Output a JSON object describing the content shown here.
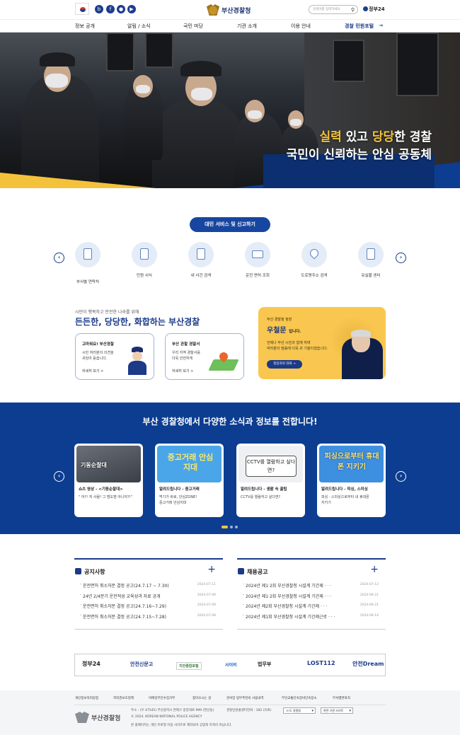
{
  "header": {
    "site_name": "부산경찰청",
    "search_placeholder": "검색어를 입력하세요",
    "gov24": "정부24",
    "nav": [
      "정보 공개",
      "알림 / 소식",
      "국민 마당",
      "기관 소개",
      "이용 안내",
      "경찰 민원포털"
    ]
  },
  "hero": {
    "line1_a": "실력",
    "line1_b": " 있고 ",
    "line1_c": "당당",
    "line1_d": "한 경찰",
    "line2": "국민이 신뢰하는 안심 공동체"
  },
  "services": {
    "title": "대민 서비스 및 신고하기",
    "items": [
      "부서별 연락처",
      "민원 서식",
      "내 사건 검색",
      "운전 면허 조회",
      "도로명주소 검색",
      "유실물 센터"
    ]
  },
  "intro": {
    "subtitle": "시민이 행복하고 안전한 나라를 위해",
    "title": "든든한, 당당한, 화합하는 부산경찰",
    "cards": [
      {
        "title": "고마워요! 부산경찰",
        "desc1": "시민 여러분의 의견을",
        "desc2": "귀담아 듣습니다.",
        "more": "자세히 보기 >"
      },
      {
        "title": "부산 관할 경찰서",
        "desc1": "우리 지역 경찰서를",
        "desc2": "더욱 안전하게",
        "more": "자세히 보기 >"
      }
    ],
    "chief": {
      "label": "부산 경찰청 청장",
      "name": "우철문",
      "suffix": "입니다.",
      "desc1": "언제나 부산 시민과 함께 하며",
      "desc2": "여러분의 말씀에 더욱 귀 기울이겠습니다.",
      "button": "청장과의 대화 →"
    }
  },
  "news": {
    "title": "부산 경찰청에서 다양한 소식과 정보를 전합니다!",
    "cards": [
      {
        "title": "쇼츠 영상 - <기동순찰대>",
        "desc1": "\" 어?! 저 사람! 그 범도범 아니야?!\"",
        "desc2": "",
        "img_text": "기동순찰대"
      },
      {
        "title": "알려드립니다 - 중고거래",
        "desc1": "먹기가 바로, 안심ZONE!",
        "desc2": "중고거래 안심지대",
        "img_text": "중고거래 안심지대"
      },
      {
        "title": "알려드립니다 - 생활 속 꿀팁",
        "desc1": "CCTV를 열람하고 싶다면?",
        "desc2": "",
        "img_text": "CCTV를 열람하고 싶다면?"
      },
      {
        "title": "알려드립니다 - 피싱, 스미싱",
        "desc1": "피싱 · 스미싱으로부터 내 휴대폰",
        "desc2": "지키기",
        "img_text": "피싱으로부터 휴대폰 지키기"
      }
    ]
  },
  "boards": {
    "notice": {
      "title": "공지사항",
      "items": [
        {
          "text": "운전면허 취소처분 결정 공고(24.7.17 ~ 7.30)",
          "date": "2024-07-11"
        },
        {
          "text": "24년 2/4분기 운전적성 교육성과 자료 공개",
          "date": "2024-07-09"
        },
        {
          "text": "운전면허 취소처분 결정 공고(24.7.16~7.29)",
          "date": "2024-07-09"
        },
        {
          "text": "운전면허 취소처분 결정 공고(24.7.15~7.28)",
          "date": "2024-07-08"
        }
      ]
    },
    "recruit": {
      "title": "채용공고",
      "items": [
        {
          "text": "2024년 제1·2회 부산경찰청 시설계 기간제 · · ·",
          "date": "2024-07-12"
        },
        {
          "text": "2024년 제1·2회 부산경찰청 시설계 기간제 · · ·",
          "date": "2024-06-21"
        },
        {
          "text": "2024년 제2회 부산경찰청 시설계 기간제 · · ·",
          "date": "2024-06-21"
        },
        {
          "text": "2024년 제1회 부산경찰청 시설계 기간제근로 · · ·",
          "date": "2024-06-14"
        }
      ]
    }
  },
  "banners": [
    "정부24",
    "안전신문고",
    "치안종합포털",
    "사이버",
    "법무부",
    "LOST112",
    "안전Dream"
  ],
  "footer": {
    "links": [
      "개인정보처리방침",
      "저작권보호정책",
      "이메일무단수집거부",
      "찾아오시는 길",
      "관서장 업무추진비 사용내역",
      "무인교통단속장비단속장소",
      "부서별연락처"
    ],
    "address": "주소 : (우 47545) 부산광역시 연제구 중앙대로 999 (연산동)",
    "phone": "경찰민원콜센터전화 : 182 (유료)",
    "copyright": "© 2024. KOREAN NATIONAL POLICE AGENCY",
    "notice": "본 홈페이지는 개인 프로필 이용 사이트로 제작되어 상업적 목적이 아닙니다.",
    "select1": "시·도 경찰청",
    "select2": "관련 기관 사이트",
    "logo": "부산경찰청"
  }
}
